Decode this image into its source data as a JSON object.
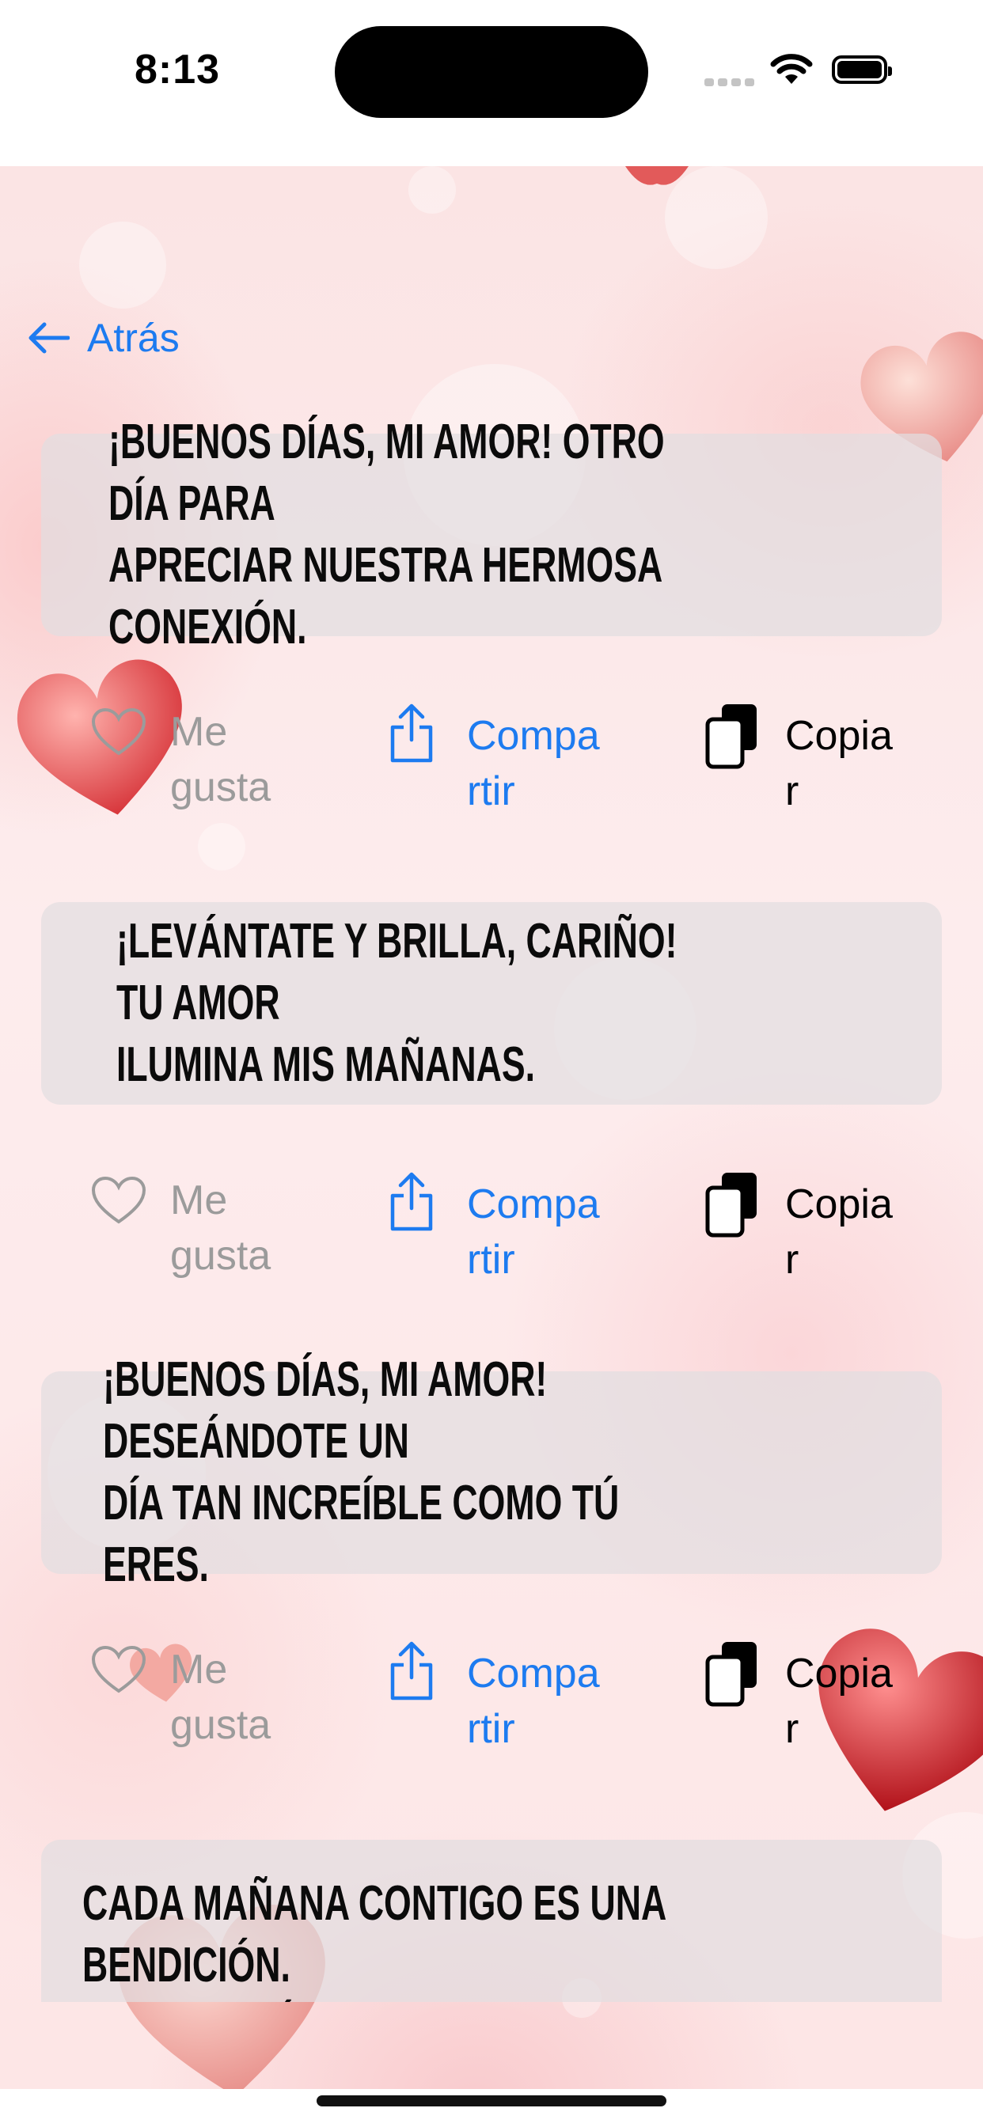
{
  "status_bar": {
    "time": "8:13"
  },
  "nav": {
    "back_label": "Atrás"
  },
  "actions": {
    "like_label": "Me\ngusta",
    "share_label": "Compa\nrtir",
    "copy_label": "Copia\nr"
  },
  "quotes": [
    {
      "text": "¡Buenos días, mi amor! Otro día para\napreciar nuestra hermosa conexión."
    },
    {
      "text": "¡Levántate y brilla, cariño! Tu amor\nilumina mis mañanas."
    },
    {
      "text": "¡Buenos días, mi amor! Deseándote un\ndía tan increíble como tú eres."
    },
    {
      "text": "Cada mañana contigo es una bendición.\n¡Buenos días, mi amor!"
    }
  ],
  "colors": {
    "accent": "#1d7bf0",
    "muted": "#9b9b9b",
    "card_bg": "#e2dee0"
  }
}
